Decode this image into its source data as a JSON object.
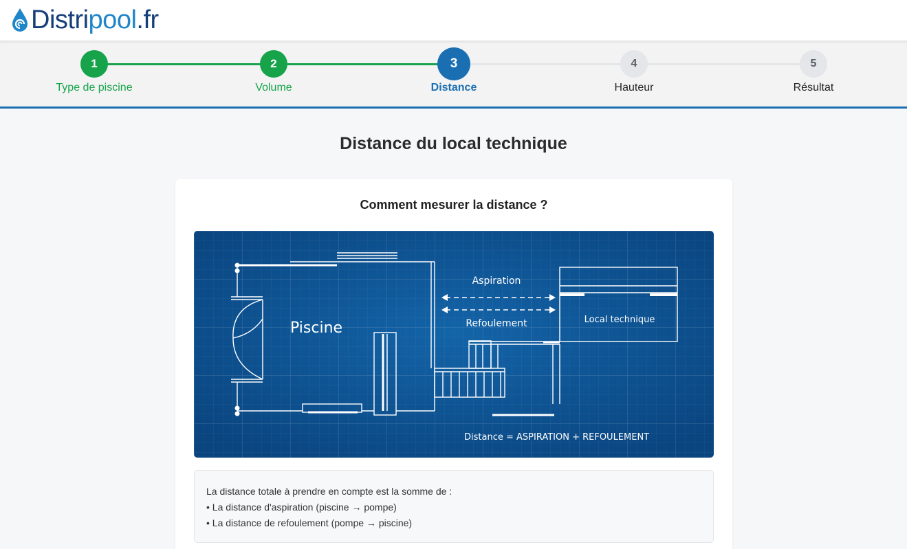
{
  "header": {
    "logo": {
      "name_dark": "Distri",
      "name_light": "pool",
      "suffix": ".fr",
      "icon": "water-drop-logo-icon",
      "colors": {
        "dark": "#163f7a",
        "light": "#1e86c9"
      }
    }
  },
  "stepper": {
    "current_step": 3,
    "colors": {
      "done": "#16a34a",
      "active": "#1a6fb3",
      "todo": "#e4e6e9"
    },
    "steps": [
      {
        "number": "1",
        "label": "Type de piscine",
        "state": "done"
      },
      {
        "number": "2",
        "label": "Volume",
        "state": "done"
      },
      {
        "number": "3",
        "label": "Distance",
        "state": "active"
      },
      {
        "number": "4",
        "label": "Hauteur",
        "state": "todo"
      },
      {
        "number": "5",
        "label": "Résultat",
        "state": "todo"
      }
    ]
  },
  "page": {
    "title": "Distance du local technique"
  },
  "card": {
    "title": "Comment mesurer la distance ?",
    "diagram": {
      "background": "#0d4f8f",
      "pool_label": "Piscine",
      "suction_label": "Aspiration",
      "return_label": "Refoulement",
      "room_label": "Local technique",
      "formula": "Distance = ASPIRATION + REFOULEMENT"
    },
    "info": {
      "intro": "La distance totale à prendre en compte est la somme de :",
      "items": [
        "• La distance d'aspiration (piscine → pompe)",
        "• La distance de refoulement (pompe → piscine)"
      ]
    }
  }
}
